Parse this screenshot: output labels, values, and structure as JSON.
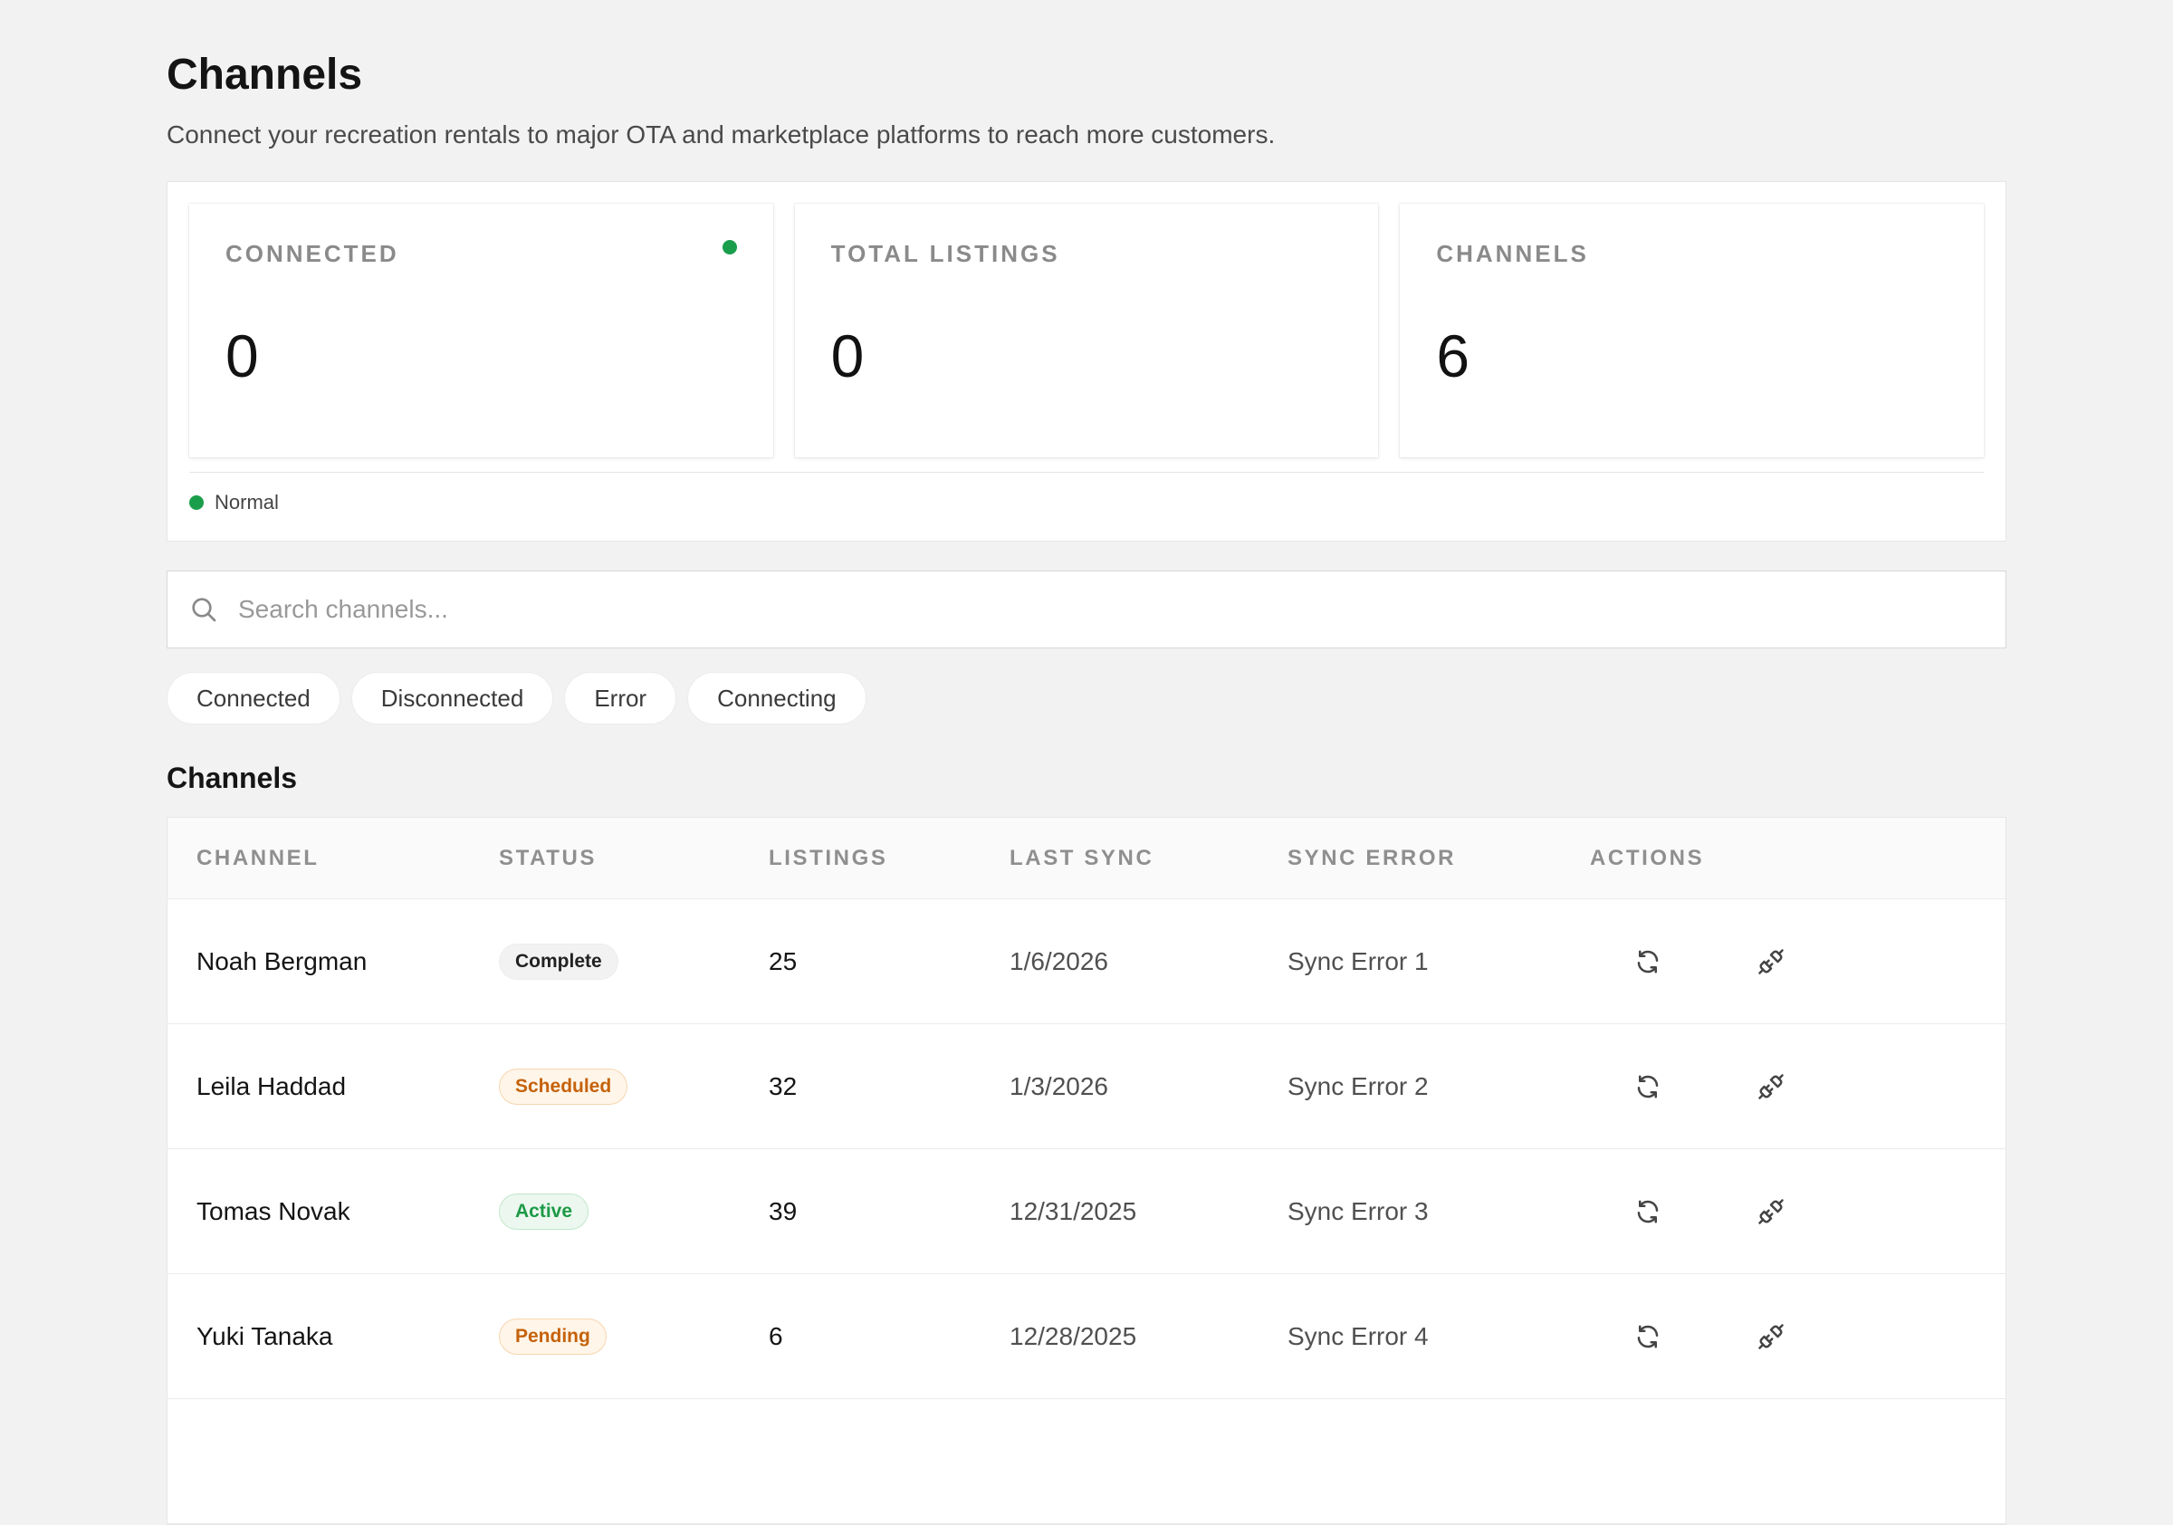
{
  "header": {
    "title": "Channels",
    "subtitle": "Connect your recreation rentals to major OTA and marketplace platforms to reach more customers."
  },
  "stats": [
    {
      "label": "CONNECTED",
      "value": "0",
      "status_color": "#1a9e4b"
    },
    {
      "label": "TOTAL LISTINGS",
      "value": "0"
    },
    {
      "label": "CHANNELS",
      "value": "6"
    }
  ],
  "health": {
    "label": "Normal",
    "color": "#1a9e4b"
  },
  "search": {
    "placeholder": "Search channels..."
  },
  "filters": [
    "Connected",
    "Disconnected",
    "Error",
    "Connecting"
  ],
  "table": {
    "title": "Channels",
    "columns": [
      "CHANNEL",
      "STATUS",
      "LISTINGS",
      "LAST SYNC",
      "SYNC ERROR",
      "ACTIONS"
    ],
    "rows": [
      {
        "channel": "Noah Bergman",
        "status": "Complete",
        "listings": "25",
        "last_sync": "1/6/2026",
        "sync_error": "Sync Error 1"
      },
      {
        "channel": "Leila Haddad",
        "status": "Scheduled",
        "listings": "32",
        "last_sync": "1/3/2026",
        "sync_error": "Sync Error 2"
      },
      {
        "channel": "Tomas Novak",
        "status": "Active",
        "listings": "39",
        "last_sync": "12/31/2025",
        "sync_error": "Sync Error 3"
      },
      {
        "channel": "Yuki Tanaka",
        "status": "Pending",
        "listings": "6",
        "last_sync": "12/28/2025",
        "sync_error": "Sync Error 4"
      }
    ]
  },
  "icons": {
    "search": "search-icon",
    "sync": "refresh-icon",
    "disconnect": "unplug-icon"
  }
}
